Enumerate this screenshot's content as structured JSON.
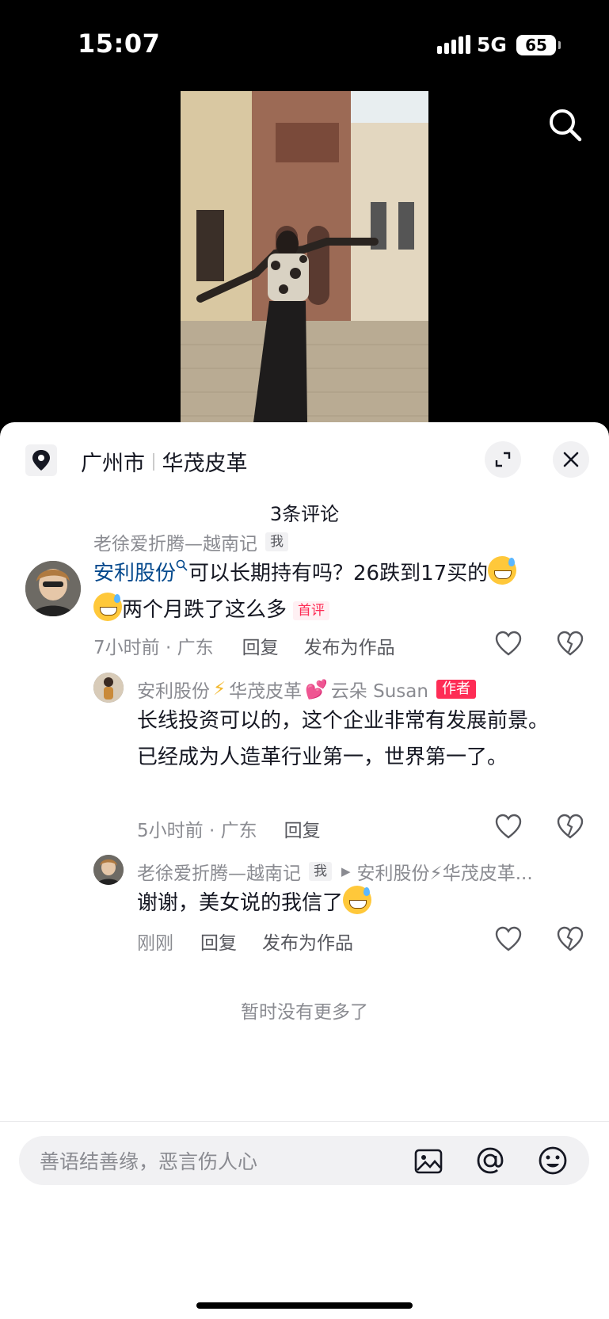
{
  "status_bar": {
    "time": "15:07",
    "network": "5G",
    "battery": "65"
  },
  "location": {
    "city": "广州市",
    "place": "华茂皮革"
  },
  "comments_count": "3条评论",
  "comments": [
    {
      "username": "老徐爱折腾—越南记",
      "me_badge": "我",
      "link_text": "安利股份",
      "text": "可以长期持有吗？26跌到17买的",
      "text_line2": "两个月跌了这么多",
      "first_badge": "首评",
      "time": "7小时前 · 广东",
      "reply": "回复",
      "publish": "发布为作品"
    },
    {
      "username_a": "安利股份",
      "username_b": "华茂皮革",
      "username_c": "云朵 Susan",
      "author_badge": "作者",
      "text": "长线投资可以的，这个企业非常有发展前景。已经成为人造革行业第一，世界第一了。",
      "time": "5小时前 · 广东",
      "reply": "回复"
    },
    {
      "username": "老徐爱折腾—越南记",
      "me_badge": "我",
      "reply_to": "安利股份⚡华茂皮革...",
      "text": "谢谢，美女说的我信了",
      "time": "刚刚",
      "reply": "回复",
      "publish": "发布为作品"
    }
  ],
  "end_note": "暂时没有更多了",
  "input": {
    "placeholder": "善语结善缘，恶言伤人心",
    "value": ""
  },
  "colors": {
    "accent": "#fe2c55",
    "link": "#04498d",
    "text": "#161823",
    "muted": "#8a8b91"
  }
}
